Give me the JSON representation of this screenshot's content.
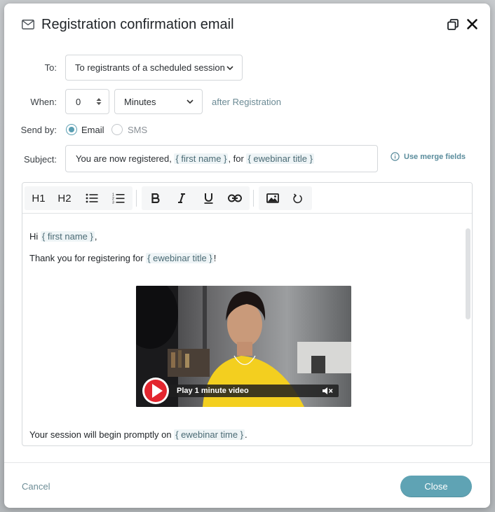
{
  "dialog": {
    "title": "Registration confirmation email"
  },
  "form": {
    "to": {
      "label": "To:",
      "value": "To registrants of a scheduled session"
    },
    "when": {
      "label": "When:",
      "amount": "0",
      "unit": "Minutes",
      "suffix": "after Registration"
    },
    "send_by": {
      "label": "Send by:",
      "options": [
        {
          "label": "Email",
          "checked": true
        },
        {
          "label": "SMS",
          "checked": false
        }
      ]
    },
    "subject": {
      "label": "Subject:",
      "prefix": "You are now registered, ",
      "merge1": "{ first name }",
      "middle": ", for ",
      "merge2": "{ ewebinar title }"
    },
    "merge_fields_link": "Use merge fields"
  },
  "toolbar": {
    "h1": "H1",
    "h2": "H2"
  },
  "body": {
    "greeting_prefix": "Hi ",
    "greeting_merge": "{ first name }",
    "greeting_suffix": ",",
    "thanks_prefix": "Thank you for registering for ",
    "thanks_merge": "{ ewebinar title }",
    "thanks_suffix": "!",
    "video_label": "Play 1 minute video",
    "session_prefix": "Your session will begin promptly on ",
    "session_merge": "{ ewebinar time }",
    "session_suffix": "."
  },
  "footer": {
    "cancel": "Cancel",
    "close": "Close"
  },
  "colors": {
    "accent": "#5fa3b4",
    "radio_checked": "#5a9eb2",
    "merge_text": "#4b6b75",
    "merge_bg": "#eef4f6"
  }
}
